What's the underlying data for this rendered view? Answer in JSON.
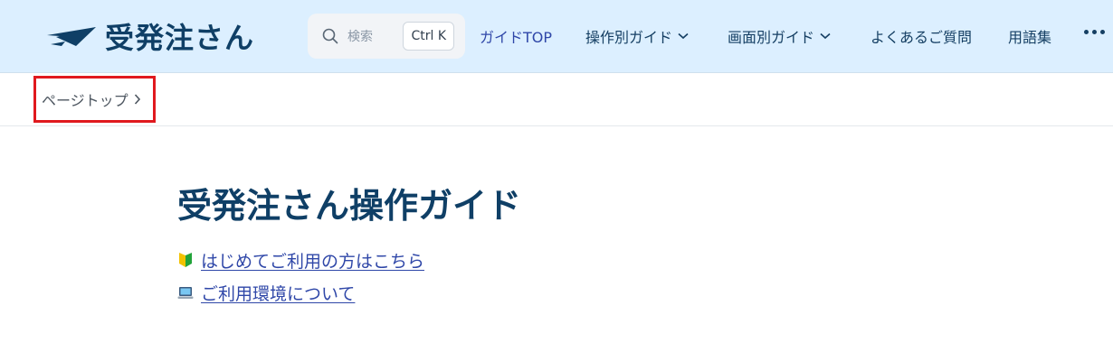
{
  "header": {
    "logo_text": "受発注さん",
    "search": {
      "placeholder": "検索",
      "shortcut": "Ctrl K"
    },
    "nav": [
      {
        "label": "ガイドTOP",
        "dropdown": false
      },
      {
        "label": "操作別ガイド",
        "dropdown": true
      },
      {
        "label": "画面別ガイド",
        "dropdown": true
      },
      {
        "label": "よくあるご質問",
        "dropdown": false
      },
      {
        "label": "用語集",
        "dropdown": false
      }
    ]
  },
  "breadcrumb": {
    "label": "ページトップ"
  },
  "main": {
    "title": "受発注さん操作ガイド",
    "links": [
      {
        "icon": "beginner-mark-icon",
        "label": "はじめてご利用の方はこちら"
      },
      {
        "icon": "laptop-icon",
        "label": "ご利用環境について"
      }
    ]
  },
  "colors": {
    "brand": "#0f3f66",
    "link": "#2f47a8",
    "header_bg": "#dcefff",
    "highlight": "#e0191e"
  }
}
